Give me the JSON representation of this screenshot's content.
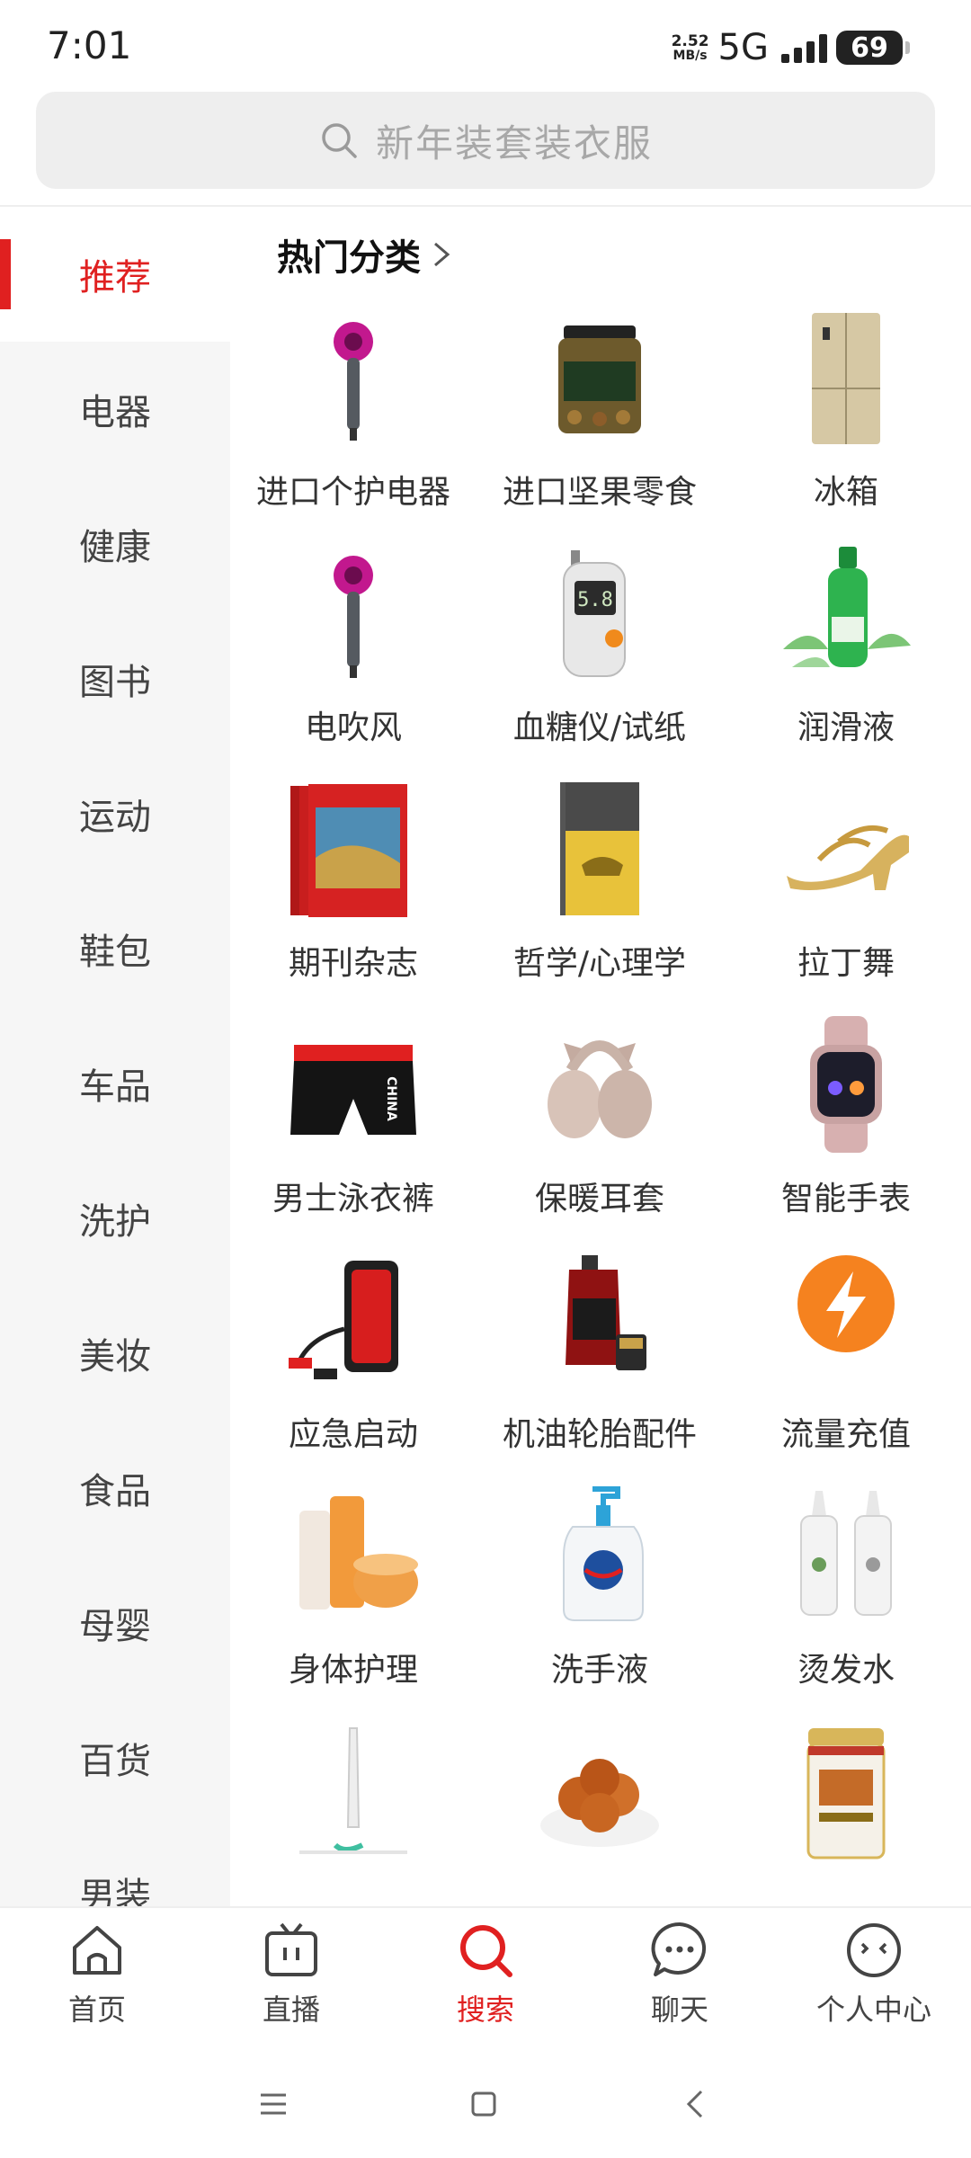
{
  "status_bar": {
    "time": "7:01",
    "net_speed_value": "2.52",
    "net_speed_unit": "MB/s",
    "network": "5G",
    "battery": "69"
  },
  "search": {
    "placeholder": "新年装套装衣服"
  },
  "sidebar": {
    "items": [
      {
        "label": "推荐",
        "active": true
      },
      {
        "label": "电器"
      },
      {
        "label": "健康"
      },
      {
        "label": "图书"
      },
      {
        "label": "运动"
      },
      {
        "label": "鞋包"
      },
      {
        "label": "车品"
      },
      {
        "label": "洗护"
      },
      {
        "label": "美妆"
      },
      {
        "label": "食品"
      },
      {
        "label": "母婴"
      },
      {
        "label": "百货"
      },
      {
        "label": "男装"
      }
    ]
  },
  "section": {
    "title": "热门分类"
  },
  "categories": [
    {
      "label": "进口个护电器",
      "icon": "hair-dryer"
    },
    {
      "label": "进口坚果零食",
      "icon": "nut-jar"
    },
    {
      "label": "冰箱",
      "icon": "refrigerator"
    },
    {
      "label": "电吹风",
      "icon": "hair-dryer"
    },
    {
      "label": "血糖仪/试纸",
      "icon": "glucose-meter"
    },
    {
      "label": "润滑液",
      "icon": "lubricant-bottle"
    },
    {
      "label": "期刊杂志",
      "icon": "magazines"
    },
    {
      "label": "哲学/心理学",
      "icon": "book"
    },
    {
      "label": "拉丁舞",
      "icon": "dance-shoe"
    },
    {
      "label": "男士泳衣裤",
      "icon": "swim-trunks"
    },
    {
      "label": "保暖耳套",
      "icon": "earmuffs"
    },
    {
      "label": "智能手表",
      "icon": "smart-watch"
    },
    {
      "label": "应急启动",
      "icon": "jump-starter"
    },
    {
      "label": "机油轮胎配件",
      "icon": "engine-oil"
    },
    {
      "label": "流量充值",
      "icon": "lightning-circle"
    },
    {
      "label": "身体护理",
      "icon": "body-care"
    },
    {
      "label": "洗手液",
      "icon": "hand-soap"
    },
    {
      "label": "烫发水",
      "icon": "perm-lotion"
    },
    {
      "label": "",
      "icon": "water-flosser"
    },
    {
      "label": "",
      "icon": "dried-fruit"
    },
    {
      "label": "",
      "icon": "protein-powder"
    }
  ],
  "bottom_nav": [
    {
      "label": "首页",
      "icon": "home-icon"
    },
    {
      "label": "直播",
      "icon": "tv-icon"
    },
    {
      "label": "搜索",
      "icon": "search-icon",
      "active": true
    },
    {
      "label": "聊天",
      "icon": "chat-icon"
    },
    {
      "label": "个人中心",
      "icon": "profile-icon"
    }
  ],
  "colors": {
    "accent": "#e02020",
    "sidebar_bg": "#f6f6f6",
    "search_bg": "#eeeeee"
  }
}
